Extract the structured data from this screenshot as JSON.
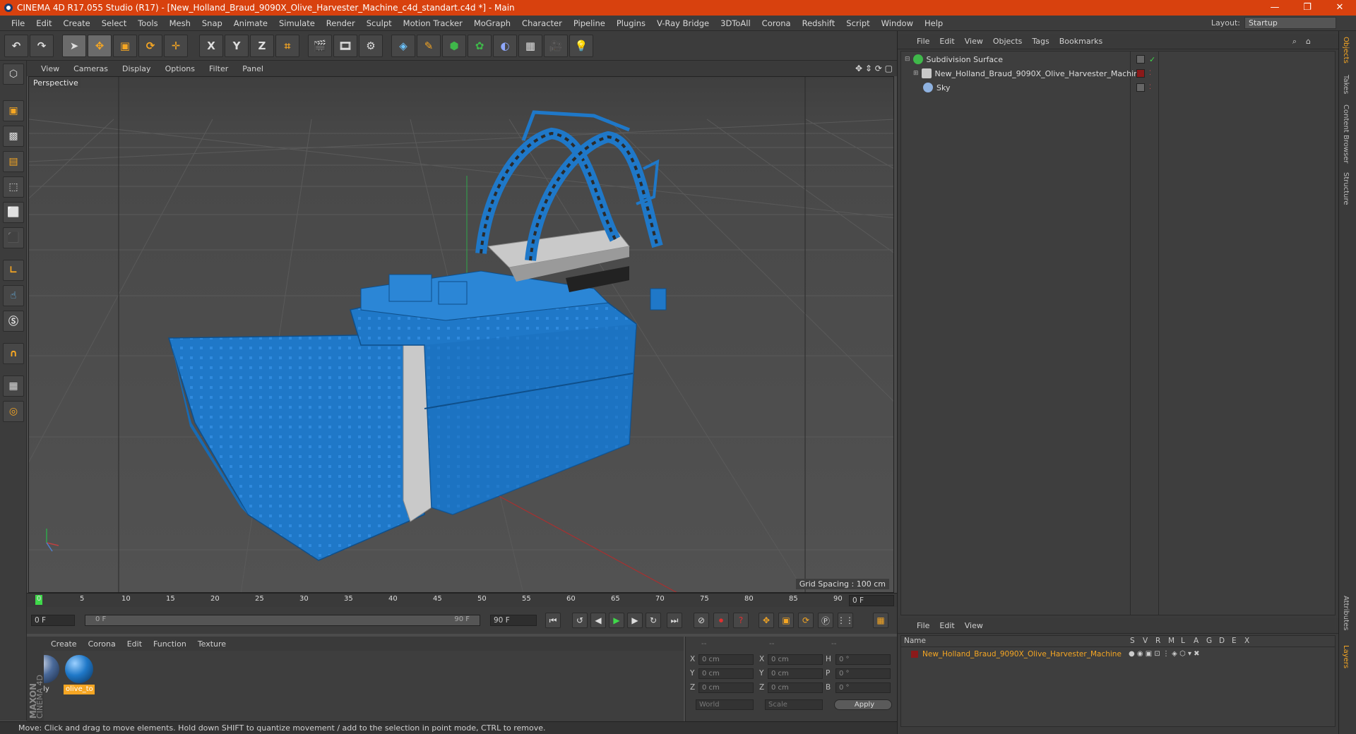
{
  "window": {
    "title": "CINEMA 4D R17.055 Studio (R17) - [New_Holland_Braud_9090X_Olive_Harvester_Machine_c4d_standart.c4d *] - Main",
    "controls": [
      "—",
      "❐",
      "✕"
    ]
  },
  "menu": {
    "items": [
      "File",
      "Edit",
      "Create",
      "Select",
      "Tools",
      "Mesh",
      "Snap",
      "Animate",
      "Simulate",
      "Render",
      "Sculpt",
      "Motion Tracker",
      "MoGraph",
      "Character",
      "Pipeline",
      "Plugins",
      "V-Ray Bridge",
      "3DToAll",
      "Corona",
      "Redshift",
      "Script",
      "Window",
      "Help"
    ],
    "layout_label": "Layout:",
    "layout_value": "Startup"
  },
  "toolbar": {
    "axis_x": "X",
    "axis_y": "Y",
    "axis_z": "Z"
  },
  "viewport": {
    "menu": [
      "View",
      "Cameras",
      "Display",
      "Options",
      "Filter",
      "Panel"
    ],
    "camera_label": "Perspective",
    "grid_spacing": "Grid Spacing : 100 cm"
  },
  "timeline": {
    "ticks": [
      "0",
      "5",
      "10",
      "15",
      "20",
      "25",
      "30",
      "35",
      "40",
      "45",
      "50",
      "55",
      "60",
      "65",
      "70",
      "75",
      "80",
      "85",
      "90"
    ],
    "current_frame": "0 F",
    "start_field": "0 F",
    "slider_start": "0 F",
    "slider_end": "90 F",
    "end_field": "90 F"
  },
  "materials": {
    "menu": [
      "Create",
      "Corona",
      "Edit",
      "Function",
      "Texture"
    ],
    "items": [
      {
        "name": "body",
        "selected": false
      },
      {
        "name": "olive_to",
        "selected": true
      }
    ]
  },
  "coordinates": {
    "headers": [
      "--",
      "--",
      "--"
    ],
    "rows": [
      {
        "a": "X",
        "av": "0 cm",
        "b": "X",
        "bv": "0 cm",
        "c": "H",
        "cv": "0 °"
      },
      {
        "a": "Y",
        "av": "0 cm",
        "b": "Y",
        "bv": "0 cm",
        "c": "P",
        "cv": "0 °"
      },
      {
        "a": "Z",
        "av": "0 cm",
        "b": "Z",
        "bv": "0 cm",
        "c": "B",
        "cv": "0 °"
      }
    ],
    "mode1": "World",
    "mode2": "Scale",
    "apply": "Apply"
  },
  "status": "Move: Click and drag to move elements. Hold down SHIFT to quantize movement / add to the selection in point mode, CTRL to remove.",
  "objects_panel": {
    "menu": [
      "File",
      "Edit",
      "View",
      "Objects",
      "Tags",
      "Bookmarks"
    ],
    "objects": [
      {
        "name": "Subdivision Surface",
        "icon_color": "#3fb84a"
      },
      {
        "name": "New_Holland_Braud_9090X_Olive_Harvester_Machine",
        "icon_color": "#c9c9c9"
      },
      {
        "name": "Sky",
        "icon_color": "#8fb2e0"
      }
    ]
  },
  "layers_panel": {
    "menu": [
      "File",
      "Edit",
      "View"
    ],
    "columns": [
      "Name",
      "S",
      "V",
      "R",
      "M",
      "L",
      "A",
      "G",
      "D",
      "E",
      "X"
    ],
    "row_name": "New_Holland_Braud_9090X_Olive_Harvester_Machine",
    "row_color": "#8b1a1a"
  },
  "side_tabs": [
    "Objects",
    "Takes",
    "Content Browser",
    "Structure",
    "Attributes",
    "Layers"
  ],
  "logo": {
    "brand": "MAXON",
    "product": "CINEMA 4D"
  },
  "colors": {
    "title_bar": "#d8410e",
    "model_blue": "#1f78c8",
    "highlight": "#f5a623"
  }
}
